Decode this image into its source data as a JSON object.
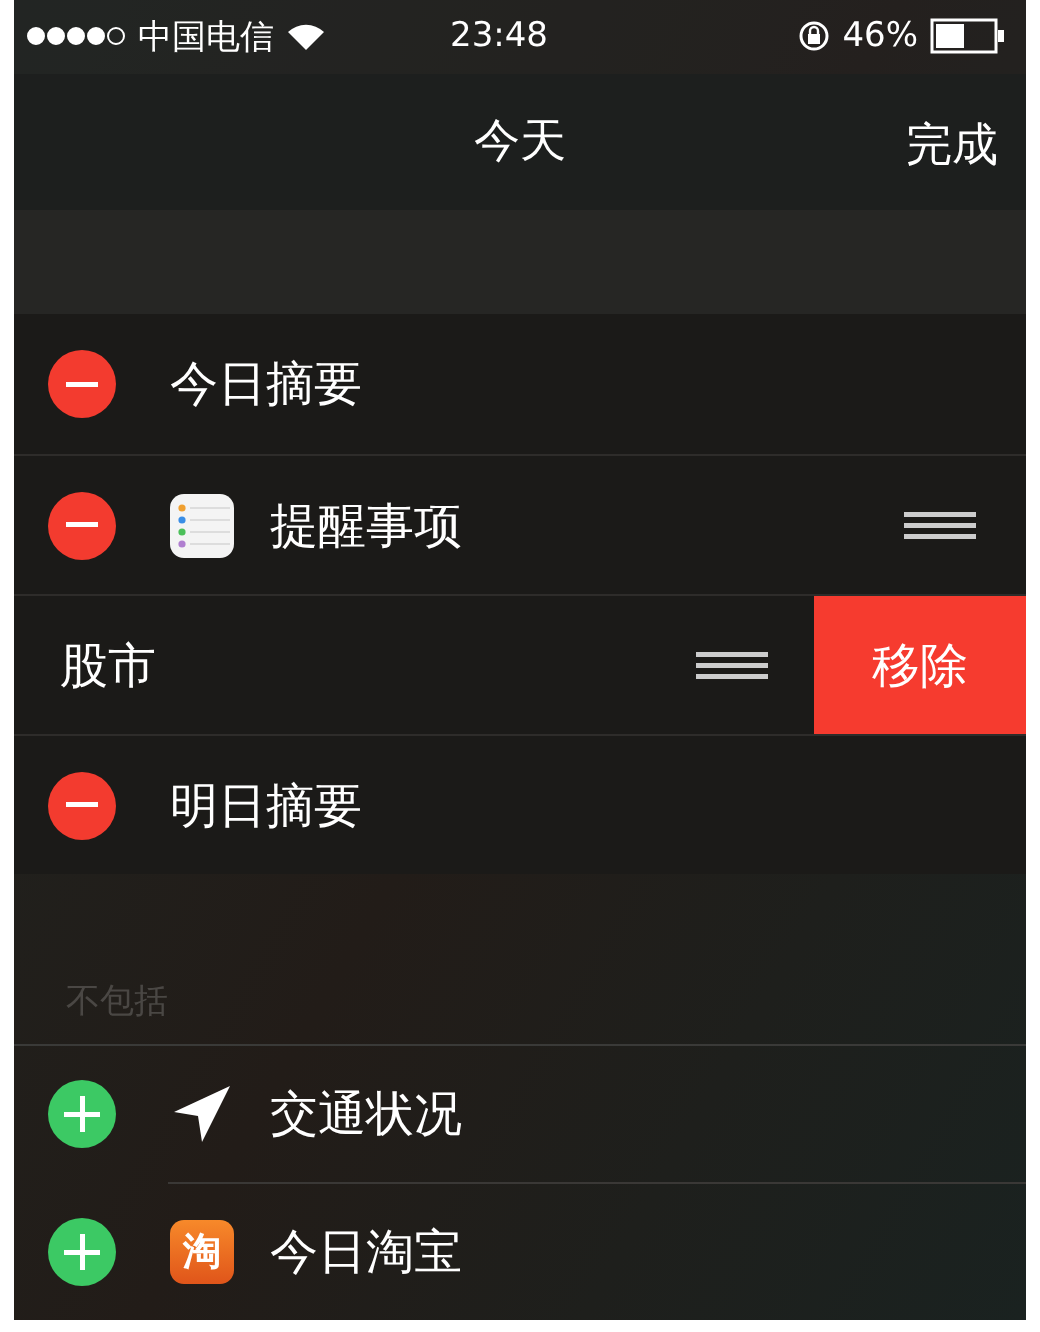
{
  "status_bar": {
    "carrier": "中国电信",
    "time": "23:48",
    "battery": "46%"
  },
  "nav": {
    "title": "今天",
    "done": "完成"
  },
  "included": [
    {
      "label": "今日摘要",
      "kind": "plain",
      "reorder": false,
      "swiped": false
    },
    {
      "label": "提醒事项",
      "kind": "reminders",
      "reorder": true,
      "swiped": false
    },
    {
      "label": "股市",
      "kind": "plain",
      "reorder": true,
      "swiped": true,
      "remove_label": "移除"
    },
    {
      "label": "明日摘要",
      "kind": "plain",
      "reorder": false,
      "swiped": false
    }
  ],
  "excluded_header": "不包括",
  "excluded": [
    {
      "label": "交通状况",
      "kind": "location"
    },
    {
      "label": "今日淘宝",
      "kind": "taobao",
      "icon_text": "淘"
    }
  ]
}
